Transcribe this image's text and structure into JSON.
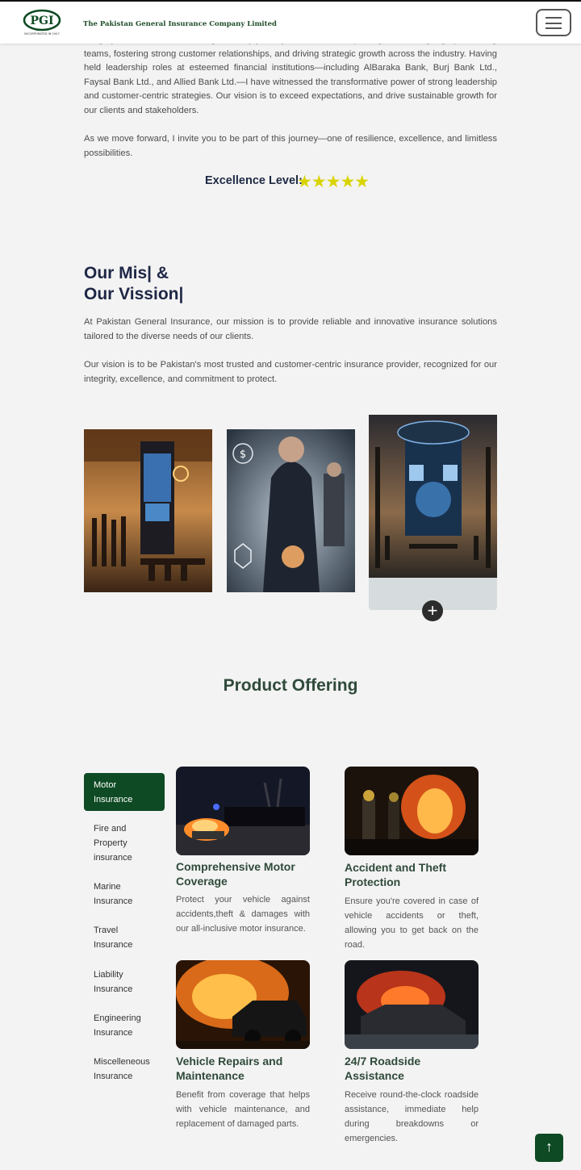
{
  "header": {
    "company_name": "The Pakistan General Insurance Company Limited",
    "logo_text": "PGI",
    "logo_subtext": "INCORPORATED IN 1947",
    "menu_icon": "hamburger-menu-icon"
  },
  "intro": {
    "para1": "integrity, and excellence – has guided my journey. I have had the privilege of leading high-performing teams, fostering strong customer relationships, and driving strategic growth across the industry. Having held leadership roles at esteemed financial institutions—including AlBaraka Bank, Burj Bank Ltd., Faysal Bank Ltd., and Allied Bank Ltd.—I have witnessed the transformative power of strong leadership and customer-centric strategies. Our vision is to exceed expectations, and drive sustainable growth for our clients and stakeholders.",
    "para2": "As we move forward, I invite you to be part of this journey—one of resilience, excellence, and limitless possibilities.",
    "excellence_label": "Excellence Level:",
    "stars": "★★★★★",
    "rating": 5,
    "rating_max": 5
  },
  "mission": {
    "title_line1": "Our Mis| &",
    "title_line2": "Our Vission|",
    "para1": "At Pakistan General Insurance, our mission is to provide reliable and innovative insurance solutions tailored to the diverse needs of our clients.",
    "para2": "Our vision is to be Pakistan's most trusted and customer-centric insurance provider, recognized for our integrity, excellence, and commitment to protect.",
    "expand_icon": "plus-circle-icon",
    "expand_symbol": "+"
  },
  "products": {
    "title": "Product Offering",
    "categories": [
      {
        "label": "Motor Insurance",
        "active": true
      },
      {
        "label": "Fire and Property insurance",
        "active": false
      },
      {
        "label": "Marine Insurance",
        "active": false
      },
      {
        "label": "Travel Insurance",
        "active": false
      },
      {
        "label": "Liability Insurance",
        "active": false
      },
      {
        "label": "Engineering Insurance",
        "active": false
      },
      {
        "label": "Miscelleneous Insurance",
        "active": false
      }
    ],
    "cards": [
      {
        "title": "Comprehensive Motor Coverage",
        "desc": "Protect your vehicle against accidents,theft & damages with our all-inclusive motor insurance."
      },
      {
        "title": "Accident and Theft Protection",
        "desc": "Ensure you're covered in case of vehicle accidents or theft, allowing you to get back on the road."
      },
      {
        "title": "Vehicle Repairs and Maintenance",
        "desc": "Benefit from coverage that helps with vehicle maintenance, and replacement of damaged parts."
      },
      {
        "title": "24/7 Roadside Assistance",
        "desc": "Receive round-the-clock roadside assistance, immediate help during breakdowns or emergencies."
      }
    ]
  },
  "back_to_top": {
    "symbol": "↑",
    "icon": "arrow-up-icon"
  },
  "colors": {
    "brand_green": "#0e4a23",
    "heading_navy": "#1e2746",
    "star_yellow": "#d9d400",
    "product_heading": "#2f4a3a"
  }
}
